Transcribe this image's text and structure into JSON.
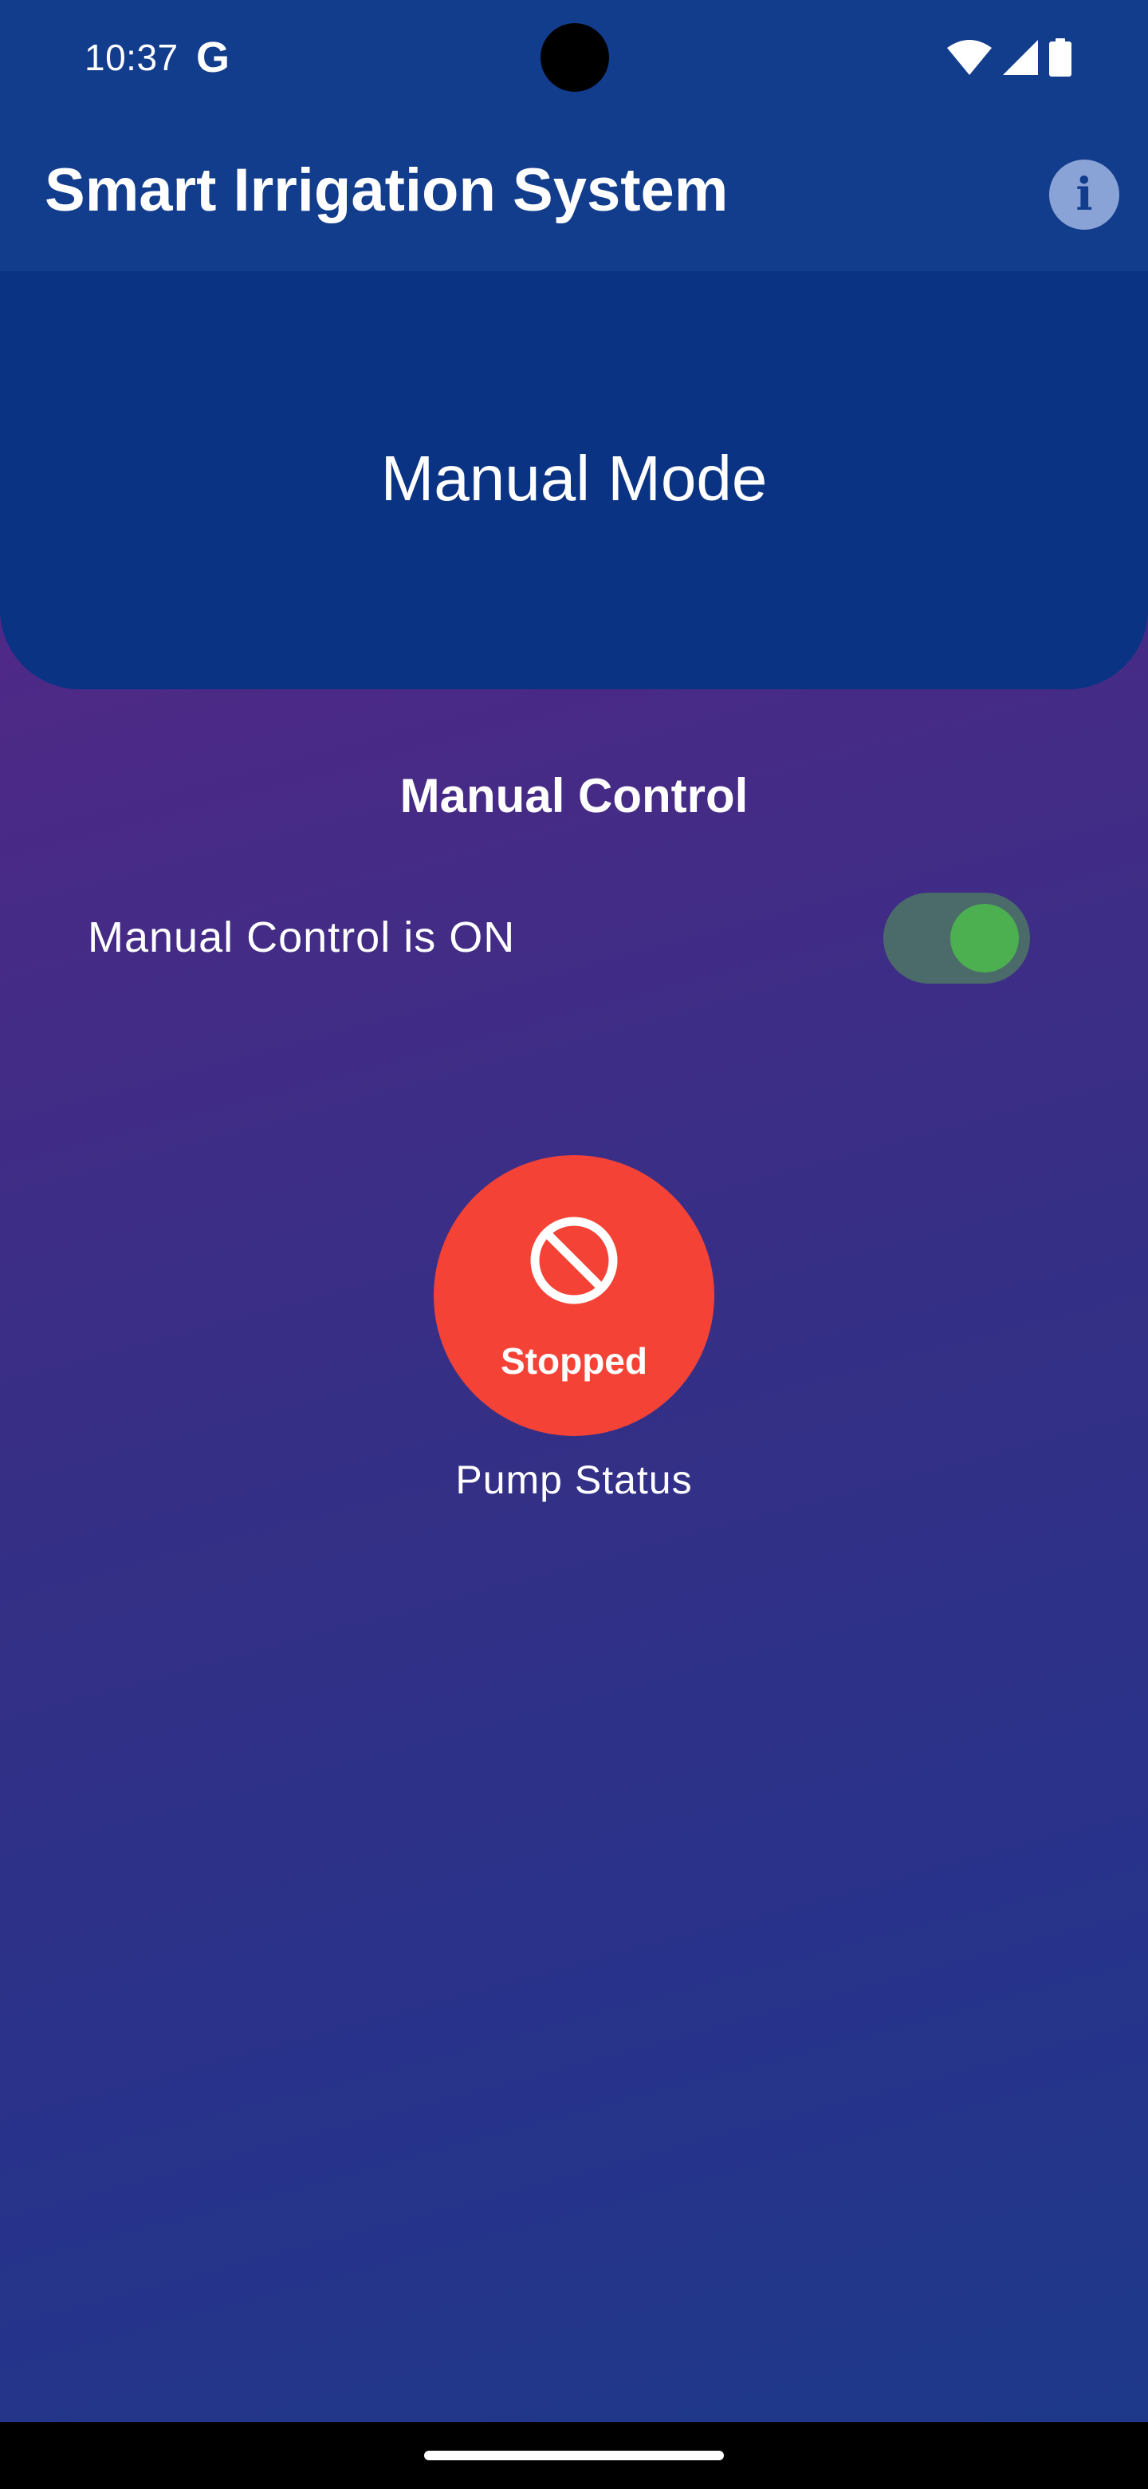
{
  "status_bar": {
    "time": "10:37",
    "google_letter": "G",
    "icons": [
      "wifi-icon",
      "signal-icon",
      "battery-icon"
    ]
  },
  "app_bar": {
    "title": "Smart Irrigation System",
    "info_icon_glyph": "i"
  },
  "mode_card": {
    "title": "Manual Mode"
  },
  "manual_control": {
    "section_title": "Manual Control",
    "toggle_label": "Manual Control is ON",
    "toggle_on": true
  },
  "pump": {
    "state": "Stopped",
    "caption": "Pump Status",
    "icon": "block-icon"
  },
  "colors": {
    "app_bar": "#123c8c",
    "mode_card": "#0a3384",
    "toggle_track": "#4b6a6a",
    "toggle_knob": "#4caf50",
    "pump_stopped": "#f44336"
  }
}
